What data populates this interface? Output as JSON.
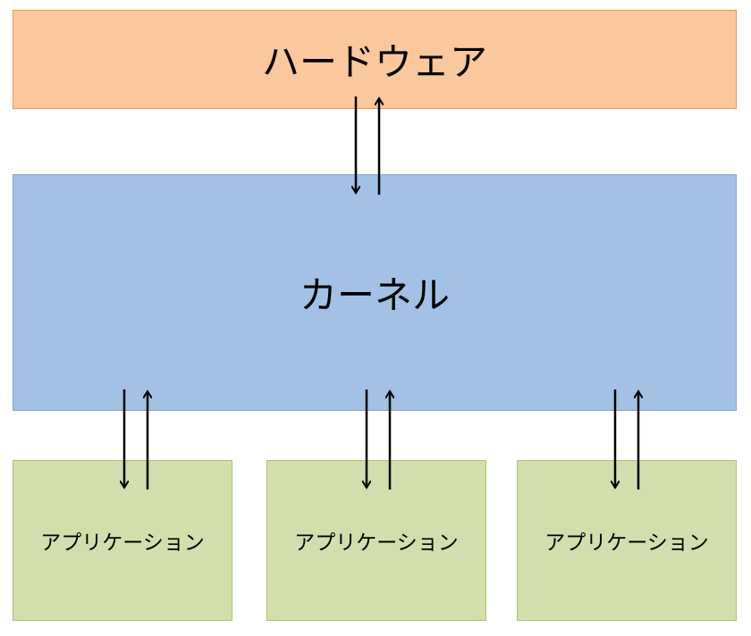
{
  "diagram": {
    "hardware": {
      "label": "ハードウェア",
      "fill": "#fac89c",
      "stroke": "#ed9651"
    },
    "kernel": {
      "label": "カーネル",
      "fill": "#a3c1e4",
      "stroke": "#84a6d2"
    },
    "applications": [
      {
        "label": "アプリケーション"
      },
      {
        "label": "アプリケーション"
      },
      {
        "label": "アプリケーション"
      }
    ],
    "app_colors": {
      "fill": "#d2dfad",
      "stroke": "#a9c56e"
    },
    "connections": [
      {
        "from": "hardware",
        "to": "kernel",
        "direction": "bidirectional"
      },
      {
        "from": "kernel",
        "to": "application-1",
        "direction": "bidirectional"
      },
      {
        "from": "kernel",
        "to": "application-2",
        "direction": "bidirectional"
      },
      {
        "from": "kernel",
        "to": "application-3",
        "direction": "bidirectional"
      }
    ]
  }
}
